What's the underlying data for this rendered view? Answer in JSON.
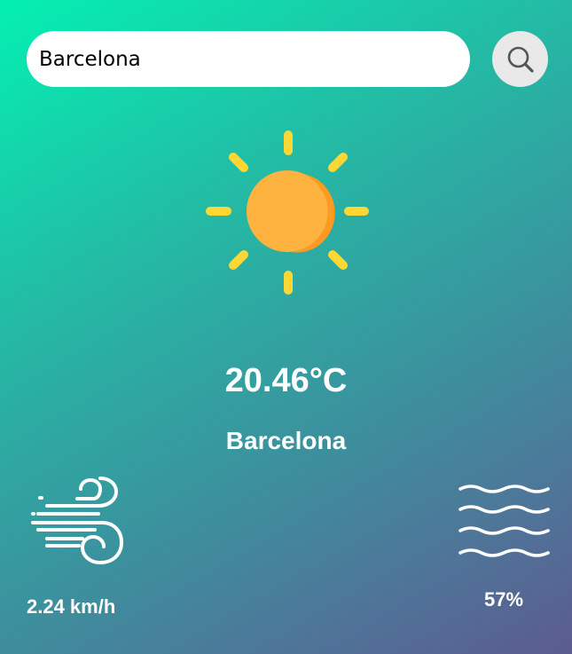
{
  "search": {
    "value": "Barcelona",
    "button_icon": "search-icon"
  },
  "weather": {
    "condition_icon": "sun-icon",
    "temperature": "20.46°C",
    "city": "Barcelona"
  },
  "details": {
    "wind": {
      "icon": "wind-icon",
      "value": "2.24 km/h"
    },
    "humidity": {
      "icon": "humidity-icon",
      "value": "57%"
    }
  },
  "colors": {
    "gradient_start": "#04f0b2",
    "gradient_end": "#5c5b8f",
    "sun_body": "#feb240",
    "sun_shade": "#fda22a",
    "sun_rays": "#fdd835",
    "text": "#ffffff"
  }
}
